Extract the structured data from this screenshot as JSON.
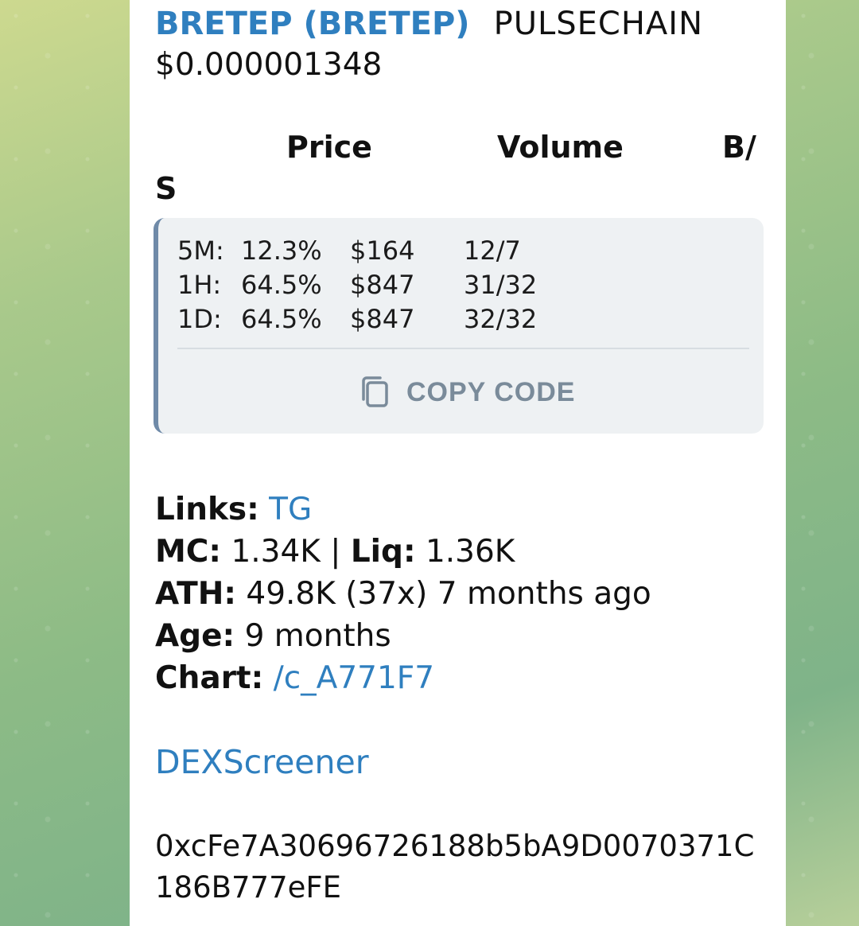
{
  "header": {
    "token_link": "BRETEP (BRETEP)",
    "chain": "PULSECHAIN",
    "price": "$0.000001348"
  },
  "table_headers": {
    "price": "Price",
    "volume": "Volume",
    "bs_part1": "B/",
    "bs_part2": "S"
  },
  "code_block": {
    "rows": [
      {
        "label": "5M:",
        "pct": "12.3%",
        "vol": "$164",
        "bs": "12/7"
      },
      {
        "label": "1H:",
        "pct": "64.5%",
        "vol": "$847",
        "bs": "31/32"
      },
      {
        "label": "1D:",
        "pct": "64.5%",
        "vol": "$847",
        "bs": "32/32"
      }
    ],
    "copy_label": "COPY CODE",
    "copy_icon": "copy-icon",
    "border_color": "#6f8aa8"
  },
  "info": {
    "links_label": "Links:",
    "links_value": "TG",
    "mc_label": "MC:",
    "mc_value": "1.34K",
    "sep": "|",
    "liq_label": "Liq:",
    "liq_value": "1.36K",
    "ath_label": "ATH:",
    "ath_value": "49.8K (37x) 7 months ago",
    "age_label": "Age:",
    "age_value": "9 months",
    "chart_label": "Chart:",
    "chart_value": "/c_A771F7"
  },
  "dexscreener": "DEXScreener",
  "address": "0xcFe7A30696726188b5bA9D0070371C186B777eFE",
  "colors": {
    "link": "#2f7fbf",
    "bubble": "#ffffff",
    "code_bg": "#eef1f3"
  }
}
